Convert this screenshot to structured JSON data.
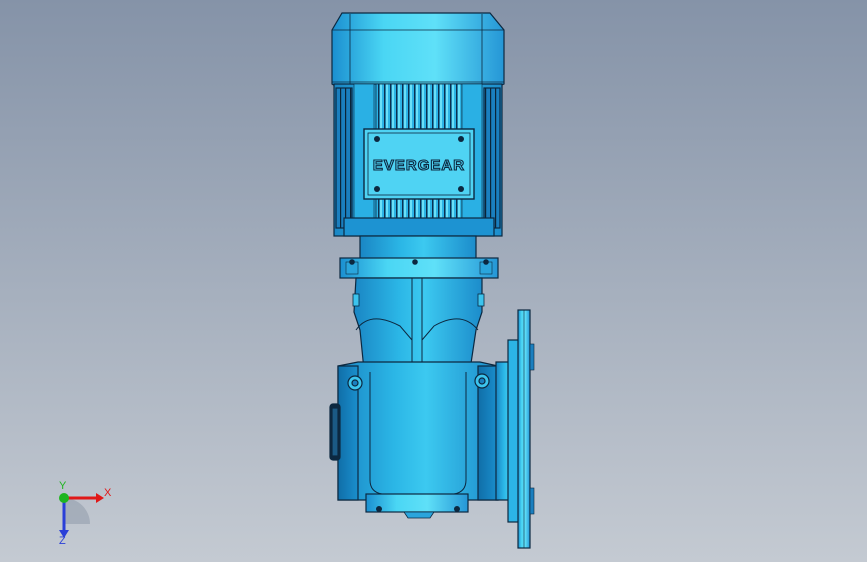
{
  "viewport": {
    "background_top": "#8593a8",
    "background_bottom": "#c4cad2"
  },
  "model": {
    "brand_plate_text": "EVERGEAR",
    "body_color": "#1e9ed8",
    "highlight_color": "#5fdcf6",
    "edge_color": "#0c2840"
  },
  "triad": {
    "x_label": "X",
    "y_label": "Y",
    "z_label": "Z",
    "x_color": "#e01818",
    "y_color": "#1fb51f",
    "z_color": "#2a3fd8"
  }
}
